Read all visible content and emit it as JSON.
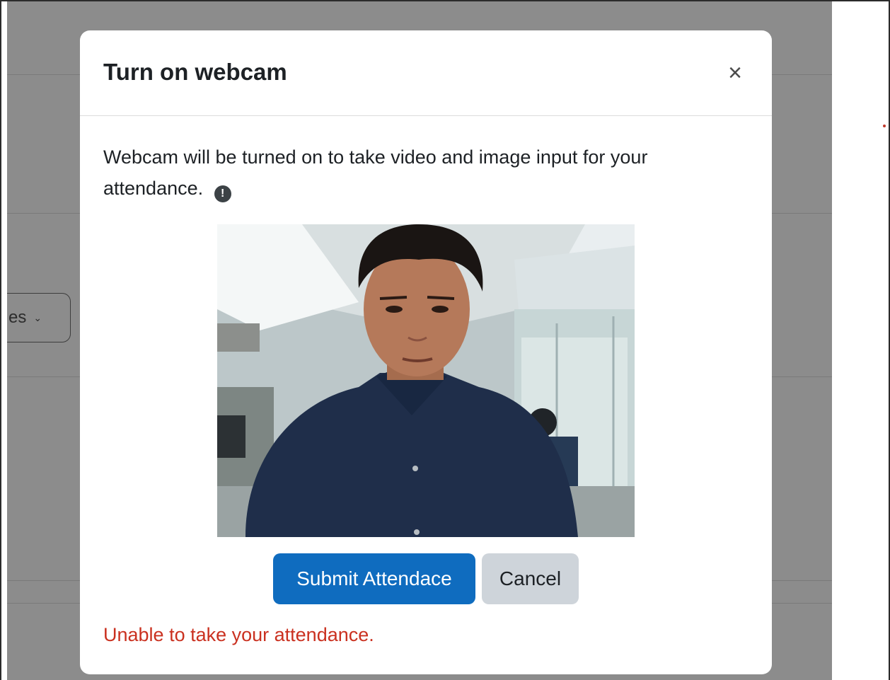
{
  "background": {
    "select_partial_label": "es",
    "overlay_color": "#8c8c8c"
  },
  "modal": {
    "title": "Turn on webcam",
    "close_icon": "close-icon",
    "description": "Webcam will be turned on to take video and image input for your attendance.",
    "info_icon": "exclamation-circle-icon",
    "video_feed": "webcam-feed",
    "buttons": {
      "submit_label": "Submit Attendace",
      "cancel_label": "Cancel"
    },
    "error_message": "Unable to take your attendance."
  },
  "colors": {
    "primary": "#0f6cbf",
    "secondary": "#ced4da",
    "error": "#ca3120",
    "title": "#1d2125"
  }
}
